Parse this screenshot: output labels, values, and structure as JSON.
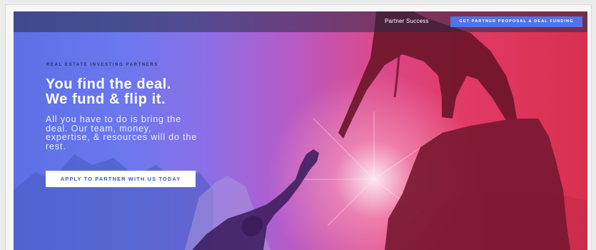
{
  "nav": {
    "link_label": "Partner Success",
    "cta_label": "GET PARTNER PROPOSAL & DEAL FUNDING"
  },
  "hero": {
    "eyebrow": "REAL ESTATE INVESTING PARTNERS",
    "headline_line1": "You find the deal.",
    "headline_line2": "We fund & flip it.",
    "subtext": "All you have to do is bring the deal. Our team, money, expertise, & resources will do the rest.",
    "cta_label": "APPLY TO PARTNER WITH US TODAY"
  },
  "colors": {
    "gradient_left": "#5d6fe6",
    "gradient_right": "#d8304e",
    "nav_cta_bg": "#4f74e8",
    "cta_text": "#3e57c8"
  }
}
